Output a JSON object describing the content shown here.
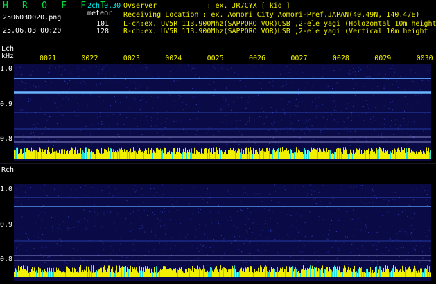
{
  "header": {
    "app_title": "H R O F F T",
    "version": "2ch 0.30",
    "filename": "2506030020.png",
    "meteor_label": "meteor",
    "datetime": "25.06.03 00:20",
    "count_l": "101",
    "count_r": "128",
    "observer": "Ovserver            : ex. JR7CYX [ kid ]",
    "location": "Receiving Location : ex. Aomori City Aomori-Pref.JAPAN(40.49N, 140.47E)",
    "lch_info": "L-ch:ex. UV5R 113.900Mhz(SAPPORO VOR)USB ,2-ele yagi (Holozontal 10m height",
    "rch_info": "R-ch:ex. UV5R 113.900Mhz(SAPPORO VOR)USB ,2-ele yagi (Vertical 10m height"
  },
  "time_labels": [
    "0021",
    "0022",
    "0023",
    "0024",
    "0025",
    "0026",
    "0027",
    "0028",
    "0029",
    "0030"
  ],
  "lch": {
    "label": "Lch",
    "unit": "kHz",
    "yticks": [
      "1.0",
      "0.9",
      "0.8"
    ]
  },
  "rch": {
    "label": "Rch",
    "yticks": [
      "1.0",
      "0.9",
      "0.8"
    ]
  },
  "colors": {
    "background": "#000000",
    "title": "#00e040",
    "version": "#00e8e8",
    "info": "#f0f000",
    "spectrogram_bg": "#0a0a46",
    "signal_line": "#5aa0ff",
    "bar_yellow": "#f0f000",
    "bar_cyan": "#20e0e0"
  }
}
